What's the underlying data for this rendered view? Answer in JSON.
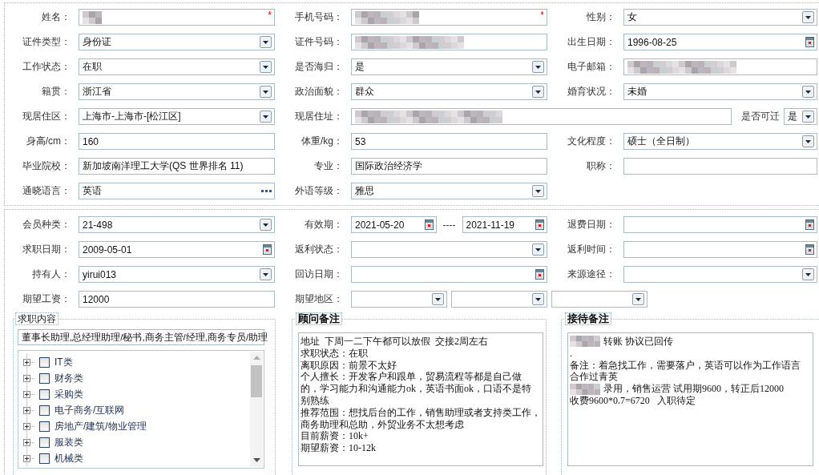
{
  "basic_info": {
    "rows": [
      [
        {
          "label": "姓名：",
          "controls": [
            {
              "kind": "masked",
              "required_mark": "*"
            }
          ]
        },
        {
          "label": "手机号码：",
          "controls": [
            {
              "kind": "masked",
              "required_mark": "*"
            }
          ]
        },
        {
          "label": "性别：",
          "controls": [
            {
              "kind": "select",
              "value": "女"
            }
          ]
        }
      ],
      [
        {
          "label": "证件类型：",
          "controls": [
            {
              "kind": "select",
              "value": "身份证"
            }
          ]
        },
        {
          "label": "证件号码：",
          "controls": [
            {
              "kind": "masked"
            }
          ]
        },
        {
          "label": "出生日期：",
          "controls": [
            {
              "kind": "date",
              "value": "1996-08-25"
            }
          ]
        }
      ],
      [
        {
          "label": "工作状态：",
          "controls": [
            {
              "kind": "select",
              "value": "在职"
            }
          ]
        },
        {
          "label": "是否海归：",
          "controls": [
            {
              "kind": "select",
              "value": "是"
            }
          ]
        },
        {
          "label": "电子邮箱：",
          "controls": [
            {
              "kind": "masked"
            }
          ]
        }
      ],
      [
        {
          "label": "籍贯：",
          "controls": [
            {
              "kind": "select",
              "value": "浙江省"
            }
          ]
        },
        {
          "label": "政治面貌：",
          "controls": [
            {
              "kind": "select",
              "value": "群众"
            }
          ]
        },
        {
          "label": "婚育状况：",
          "controls": [
            {
              "kind": "select",
              "value": "未婚"
            }
          ]
        }
      ],
      [
        {
          "label": "现居住区：",
          "controls": [
            {
              "kind": "select",
              "value": "上海市-上海市-[松江区]"
            }
          ]
        },
        {
          "label": "现居住址：",
          "controls": [
            {
              "kind": "masked"
            },
            {
              "kind": "caption",
              "text": "是否可迁"
            },
            {
              "kind": "select",
              "value": "是"
            }
          ]
        }
      ],
      [
        {
          "label": "身高/cm：",
          "controls": [
            {
              "kind": "text",
              "value": "160"
            }
          ]
        },
        {
          "label": "体重/kg：",
          "controls": [
            {
              "kind": "text",
              "value": "53"
            }
          ]
        },
        {
          "label": "文化程度：",
          "controls": [
            {
              "kind": "select",
              "value": "硕士（全日制）"
            }
          ]
        }
      ],
      [
        {
          "label": "毕业院校：",
          "controls": [
            {
              "kind": "text",
              "value": "新加坡南洋理工大学(QS 世界排名 11)"
            }
          ]
        },
        {
          "label": "专业：",
          "controls": [
            {
              "kind": "text",
              "value": "国际政治经济学"
            }
          ]
        },
        {
          "label": "职称：",
          "controls": [
            {
              "kind": "text"
            }
          ]
        }
      ],
      [
        {
          "label": "通晓语言：",
          "controls": [
            {
              "kind": "lookup",
              "value": "英语"
            }
          ]
        },
        {
          "label": "外语等级：",
          "controls": [
            {
              "kind": "select",
              "value": "雅思"
            }
          ]
        }
      ]
    ]
  },
  "membership": {
    "rows": [
      [
        {
          "label": "会员种类：",
          "controls": [
            {
              "kind": "select",
              "value": "21-498"
            }
          ]
        },
        {
          "label": "有效期：",
          "controls": [
            {
              "kind": "date",
              "value": "2021-05-20"
            },
            {
              "kind": "separator",
              "text": "----"
            },
            {
              "kind": "date",
              "value": "2021-11-19"
            }
          ]
        },
        {
          "label": "退费日期：",
          "controls": [
            {
              "kind": "date"
            }
          ]
        }
      ],
      [
        {
          "label": "求职日期：",
          "controls": [
            {
              "kind": "date",
              "value": "2009-05-01"
            }
          ]
        },
        {
          "label": "返利状态：",
          "controls": [
            {
              "kind": "select"
            }
          ]
        },
        {
          "label": "返利时间：",
          "controls": [
            {
              "kind": "date"
            }
          ]
        }
      ],
      [
        {
          "label": "持有人：",
          "controls": [
            {
              "kind": "select",
              "value": "yirui013"
            }
          ]
        },
        {
          "label": "回访日期：",
          "controls": [
            {
              "kind": "date"
            }
          ]
        },
        {
          "label": "来源途径：",
          "controls": [
            {
              "kind": "select"
            }
          ]
        }
      ],
      [
        {
          "label": "期望工资：",
          "controls": [
            {
              "kind": "text",
              "value": "12000"
            }
          ]
        },
        {
          "label": "期望地区：",
          "controls": [
            {
              "kind": "select"
            },
            {
              "kind": "select"
            },
            {
              "kind": "select"
            }
          ]
        }
      ]
    ]
  },
  "job_intention": {
    "title": "求职内容",
    "summary_field": {
      "value": "董事长助理,总经理助理/秘书,商务主管/经理,商务专员/助理"
    },
    "categories": [
      {
        "label": "IT类",
        "expanded": false,
        "checked": false
      },
      {
        "label": "财务类",
        "expanded": false,
        "checked": false
      },
      {
        "label": "采购类",
        "expanded": false,
        "checked": false
      },
      {
        "label": "电子商务/互联网",
        "expanded": false,
        "checked": false
      },
      {
        "label": "房地产/建筑/物业管理",
        "expanded": false,
        "checked": false
      },
      {
        "label": "服装类",
        "expanded": false,
        "checked": false
      },
      {
        "label": "机械类",
        "expanded": false,
        "checked": false
      }
    ]
  },
  "advisor_notes": {
    "title": "顾问备注",
    "lines": [
      {
        "kind": "plain",
        "text": "地址  下周一二下午都可以放假  交接2周左右"
      },
      {
        "kind": "plain",
        "text": "求职状态：在职"
      },
      {
        "kind": "plain",
        "text": "离职原因：前景不太好"
      },
      {
        "kind": "plain",
        "text": "个人擅长：开发客户和跟单，贸易流程等都是自己做"
      },
      {
        "kind": "plain",
        "text": "的，学习能力和沟通能力ok，英语书面ok，口语不是特"
      },
      {
        "kind": "plain",
        "text": "别熟练"
      },
      {
        "kind": "plain",
        "text": "推荐范围：想找后台的工作，销售助理或者支持类工作，"
      },
      {
        "kind": "plain",
        "text": "商务助理和总助，外贸业务不太想考虑"
      },
      {
        "kind": "plain",
        "text": "目前薪资：10k+"
      },
      {
        "kind": "plain",
        "text": "期望薪资：10-12k"
      }
    ]
  },
  "reception_notes": {
    "title": "接待备注",
    "lines": [
      {
        "kind": "masked",
        "text": "转账 协议已回传"
      },
      {
        "kind": "plain",
        "text": "."
      },
      {
        "kind": "plain",
        "text": "备注：着急找工作，需要落户，英语可以作为工作语言"
      },
      {
        "kind": "plain",
        "text": "合作过青英"
      },
      {
        "kind": "masked",
        "text": "录用，销售运营 试用期9600，转正后12000"
      },
      {
        "kind": "plain",
        "text": "收费9600*0.7=6720   入职待定"
      }
    ]
  }
}
